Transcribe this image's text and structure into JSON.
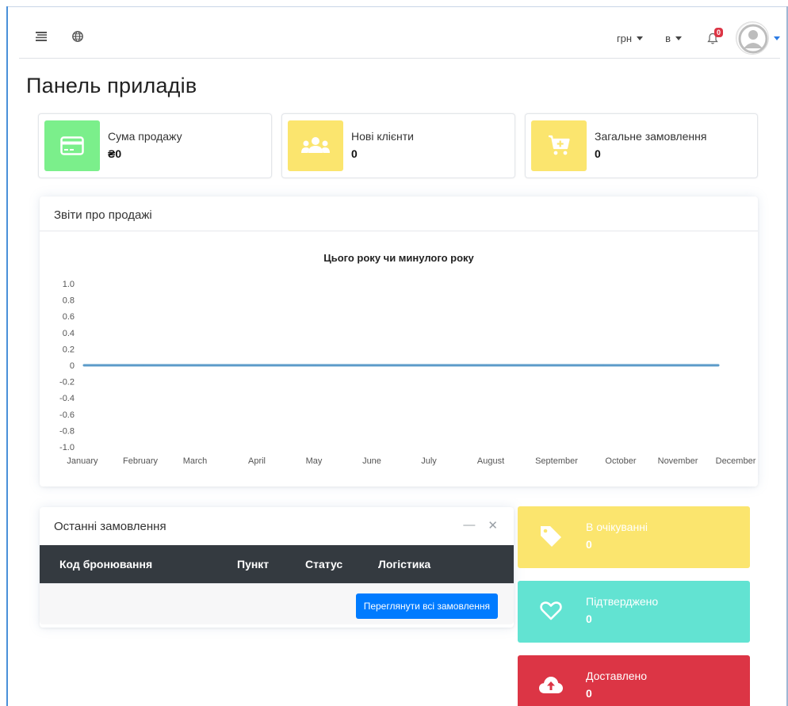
{
  "navbar": {
    "currency": "грн",
    "language": "в",
    "notifications_count": "0"
  },
  "page_title": "Панель приладів",
  "info_boxes": [
    {
      "label": "Сума продажу",
      "value": "₴0",
      "color": "#7bef8b",
      "icon": "credit-card-icon"
    },
    {
      "label": "Нові клієнти",
      "value": "0",
      "color": "#fbe56e",
      "icon": "users-icon"
    },
    {
      "label": "Загальне замовлення",
      "value": "0",
      "color": "#fbe56e",
      "icon": "cart-plus-icon"
    }
  ],
  "sales_card": {
    "header": "Звіти про продажі"
  },
  "chart_data": {
    "type": "line",
    "title": "Цього року чи минулого року",
    "categories": [
      "January",
      "February",
      "March",
      "April",
      "May",
      "June",
      "July",
      "August",
      "September",
      "October",
      "November",
      "December"
    ],
    "series": [
      {
        "values": [
          0,
          0,
          0,
          0,
          0,
          0,
          0,
          0,
          0,
          0,
          0,
          0
        ],
        "color": "#5b9bc9"
      }
    ],
    "yticks": [
      "1.0",
      "0.8",
      "0.6",
      "0.4",
      "0.2",
      "0",
      "-0.2",
      "-0.4",
      "-0.6",
      "-0.8",
      "-1.0"
    ],
    "ylim": [
      -1.0,
      1.0
    ],
    "grid": false
  },
  "orders_card": {
    "header": "Останні замовлення",
    "columns": [
      "Код бронювання",
      "Пункт",
      "Статус",
      "Логістика"
    ],
    "button": "Переглянути всі замовлення"
  },
  "status_boxes": [
    {
      "label": "В очікуванні",
      "value": "0",
      "color": "#fbe56e",
      "icon": "tag-icon"
    },
    {
      "label": "Підтверджено",
      "value": "0",
      "color": "#62e3d2",
      "icon": "heart-icon"
    },
    {
      "label": "Доставлено",
      "value": "0",
      "color": "#dc3545",
      "icon": "cloud-upload-icon"
    }
  ]
}
